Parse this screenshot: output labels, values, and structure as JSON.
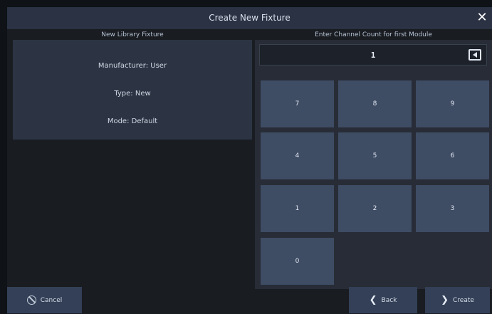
{
  "window": {
    "title": "Create New Fixture",
    "close_label": "✕"
  },
  "left": {
    "heading": "New Library Fixture",
    "manufacturer": "Manufacturer: User",
    "type": "Type: New",
    "mode": "Mode: Default"
  },
  "right": {
    "heading": "Enter Channel Count for first Module",
    "entry_value": "1"
  },
  "keypad": {
    "keys": [
      "7",
      "8",
      "9",
      "4",
      "5",
      "6",
      "1",
      "2",
      "3",
      "0"
    ]
  },
  "buttons": {
    "cancel": "Cancel",
    "back": "Back",
    "create": "Create",
    "back_chevron": "❮",
    "create_chevron": "❯"
  },
  "icons": [
    "close-icon",
    "backspace-icon",
    "cancel-icon",
    "chevron-left-icon",
    "chevron-right-icon"
  ]
}
